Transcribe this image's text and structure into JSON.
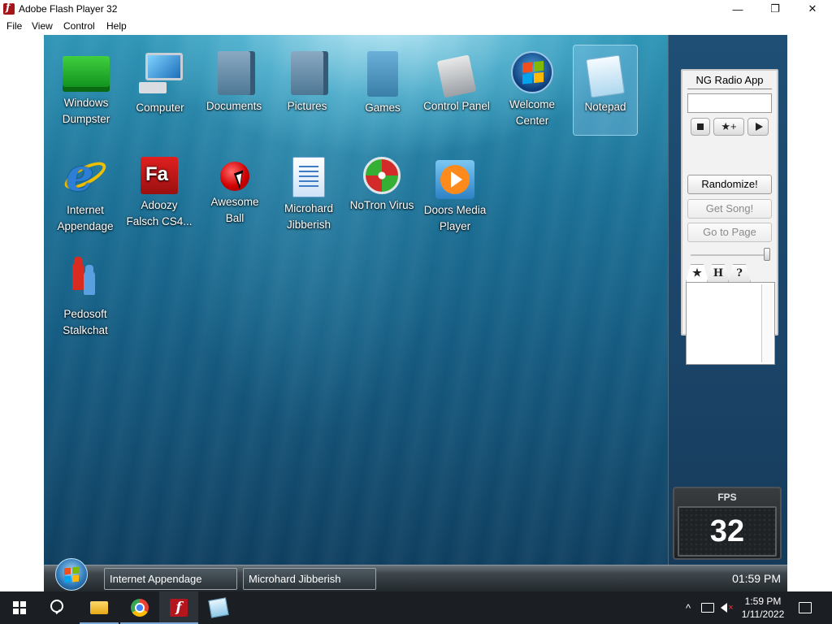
{
  "window": {
    "title": "Adobe Flash Player 32",
    "minimize_glyph": "—",
    "maximize_glyph": "❐",
    "close_glyph": "✕"
  },
  "menu": [
    "File",
    "View",
    "Control",
    "Help"
  ],
  "desktop_icons": [
    {
      "label": "Windows Dumpster",
      "icon": "dumpster-icon"
    },
    {
      "label": "Computer",
      "icon": "computer-icon"
    },
    {
      "label": "Documents",
      "icon": "documents-icon"
    },
    {
      "label": "Pictures",
      "icon": "pictures-icon"
    },
    {
      "label": "Games",
      "icon": "games-icon"
    },
    {
      "label": "Control Panel",
      "icon": "control-panel-icon"
    },
    {
      "label": "Welcome Center",
      "icon": "welcome-center-icon"
    },
    {
      "label": "Notepad",
      "icon": "notepad-icon",
      "selected": true
    },
    {
      "label": "Internet Appendage",
      "icon": "internet-explorer-icon"
    },
    {
      "label": "Adoozy Falsch CS4...",
      "icon": "adobe-flash-icon"
    },
    {
      "label": "Awesome Ball",
      "icon": "red-ball-icon"
    },
    {
      "label": "Microhard Jibberish",
      "icon": "document-icon"
    },
    {
      "label": "NoTron Virus",
      "icon": "antivirus-icon"
    },
    {
      "label": "Doors Media Player",
      "icon": "media-player-icon"
    },
    {
      "label": "Pedosoft Stalkchat",
      "icon": "chat-people-icon"
    }
  ],
  "radio": {
    "title": "NG Radio App",
    "input_value": "",
    "fav_label": "★+",
    "randomize": "Randomize!",
    "get_song": "Get Song!",
    "go_to_page": "Go to Page",
    "tabs": [
      "★",
      "H",
      "?"
    ],
    "volume": 1.0
  },
  "fps": {
    "label": "FPS",
    "value": "32"
  },
  "emu_taskbar": {
    "tasks": [
      "Internet Appendage",
      "Microhard Jibberish"
    ],
    "clock": "01:59 PM"
  },
  "host_taskbar": {
    "time": "1:59 PM",
    "date": "1/11/2022",
    "tray_chevron": "^"
  },
  "colors": {
    "desktop_top": "#2f95b6",
    "desktop_bottom": "#0f3f60",
    "flash_red": "#a3151b"
  }
}
